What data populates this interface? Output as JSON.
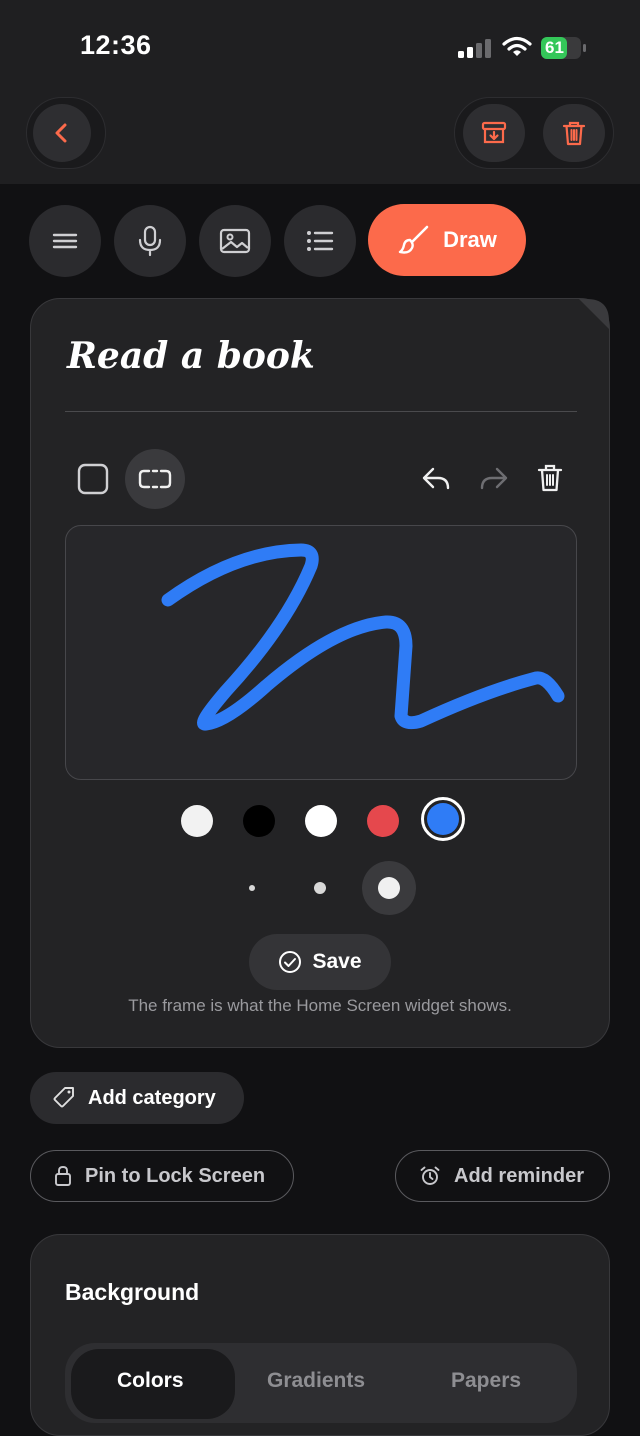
{
  "status_bar": {
    "time": "12:36",
    "battery": "61"
  },
  "toolbar": {
    "draw_label": "Draw"
  },
  "note": {
    "title": "Read a book",
    "save_label": "Save",
    "hint": "The frame is what the Home Screen widget shows."
  },
  "palette": {
    "colors": [
      "#f2f2f2",
      "#000000",
      "#ffffff",
      "#e5484d",
      "#2f7cf6"
    ],
    "selected_color": "#2f7cf6",
    "brush_sizes": [
      "small",
      "medium",
      "large"
    ],
    "selected_size": "large"
  },
  "actions": {
    "add_category": "Add category",
    "pin_lock": "Pin to Lock Screen",
    "add_reminder": "Add reminder"
  },
  "background": {
    "title": "Background",
    "tabs": [
      "Colors",
      "Gradients",
      "Papers"
    ],
    "active_tab": "Colors"
  },
  "accent": "#fc6a4b"
}
